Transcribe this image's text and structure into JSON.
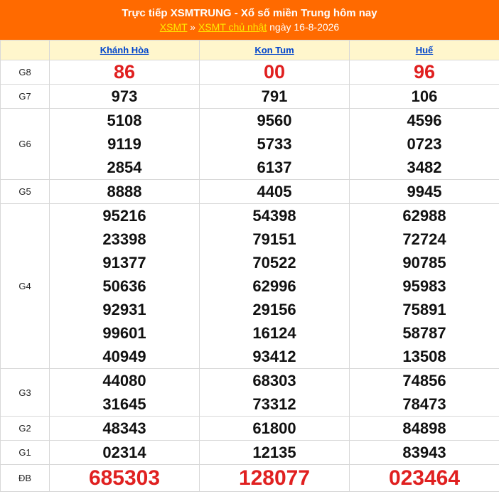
{
  "header": {
    "title": "Trực tiếp XSMTRUNG - Xổ số miền Trung hôm nay",
    "link1": "XSMT",
    "sep": " » ",
    "link2": "XSMT chủ nhật",
    "date_text": " ngày 16-8-2026"
  },
  "provinces": [
    "Khánh Hòa",
    "Kon Tum",
    "Huế"
  ],
  "prizes": [
    {
      "label": "G8",
      "values": [
        [
          "86"
        ],
        [
          "00"
        ],
        [
          "96"
        ]
      ]
    },
    {
      "label": "G7",
      "values": [
        [
          "973"
        ],
        [
          "791"
        ],
        [
          "106"
        ]
      ]
    },
    {
      "label": "G6",
      "values": [
        [
          "5108",
          "9119",
          "2854"
        ],
        [
          "9560",
          "5733",
          "6137"
        ],
        [
          "4596",
          "0723",
          "3482"
        ]
      ]
    },
    {
      "label": "G5",
      "values": [
        [
          "8888"
        ],
        [
          "4405"
        ],
        [
          "9945"
        ]
      ]
    },
    {
      "label": "G4",
      "values": [
        [
          "95216",
          "23398",
          "91377",
          "50636",
          "92931",
          "99601",
          "40949"
        ],
        [
          "54398",
          "79151",
          "70522",
          "62996",
          "29156",
          "16124",
          "93412"
        ],
        [
          "62988",
          "72724",
          "90785",
          "95983",
          "75891",
          "58787",
          "13508"
        ]
      ]
    },
    {
      "label": "G3",
      "values": [
        [
          "44080",
          "31645"
        ],
        [
          "68303",
          "73312"
        ],
        [
          "74856",
          "78473"
        ]
      ]
    },
    {
      "label": "G2",
      "values": [
        [
          "48343"
        ],
        [
          "61800"
        ],
        [
          "84898"
        ]
      ]
    },
    {
      "label": "G1",
      "values": [
        [
          "02314"
        ],
        [
          "12135"
        ],
        [
          "83943"
        ]
      ]
    },
    {
      "label": "ĐB",
      "values": [
        [
          "685303"
        ],
        [
          "128077"
        ],
        [
          "023464"
        ]
      ]
    }
  ]
}
